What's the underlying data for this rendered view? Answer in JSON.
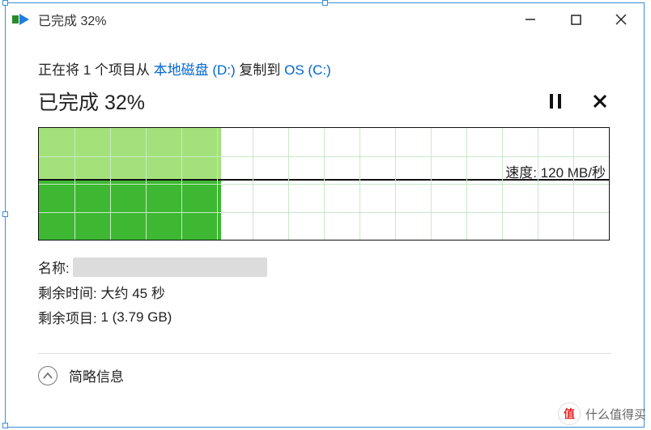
{
  "titlebar": {
    "title": "已完成 32%"
  },
  "copy_line": {
    "prefix": "正在将 1 个项目从 ",
    "source": "本地磁盘 (D:)",
    "middle": " 复制到 ",
    "dest": "OS (C:)"
  },
  "progress": {
    "title": "已完成 32%",
    "percent": 32
  },
  "chart_data": {
    "type": "area",
    "title": "",
    "xlabel": "",
    "ylabel": "",
    "x": [
      0,
      10,
      20,
      30,
      32
    ],
    "values": [
      120,
      120,
      120,
      120,
      120
    ],
    "ylim": [
      0,
      220
    ],
    "progress_percent": 32,
    "current_speed_label": "速度: 120 MB/秒",
    "grid": {
      "v_columns": 16,
      "h_rows": 4
    }
  },
  "info": {
    "name_label": "名称:",
    "name_value": "",
    "time_remaining_label": "剩余时间:",
    "time_remaining_value": "大约 45 秒",
    "items_remaining_label": "剩余项目:",
    "items_remaining_value": "1 (3.79 GB)"
  },
  "footer": {
    "toggle_label": "简略信息"
  },
  "watermark": {
    "badge": "值",
    "text": "什么值得买"
  }
}
